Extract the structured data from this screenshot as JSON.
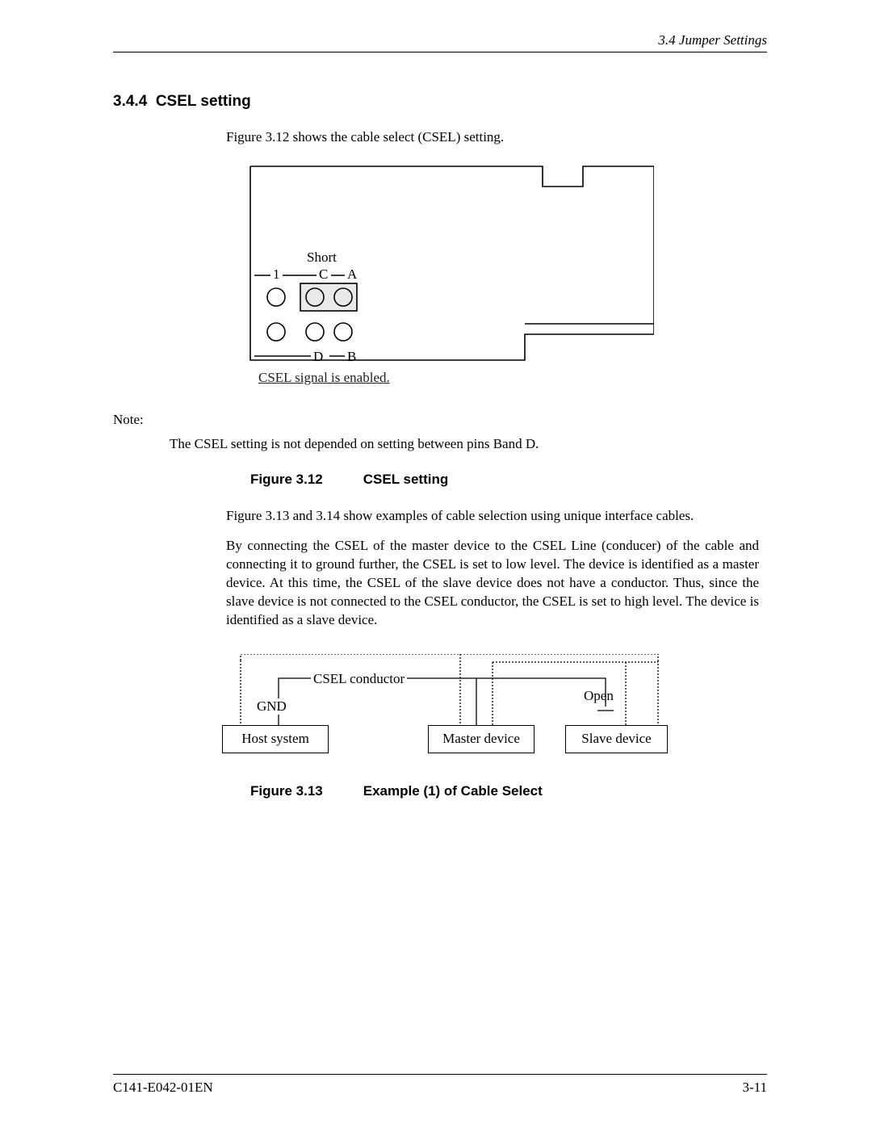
{
  "header": {
    "section_ref": "3.4  Jumper Settings"
  },
  "section": {
    "number": "3.4.4",
    "title": "CSEL setting"
  },
  "intro": "Figure 3.12 shows the cable select (CSEL) setting.",
  "fig312": {
    "short": "Short",
    "one": "1",
    "C": "C",
    "A": "A",
    "D": "D",
    "B": "B",
    "caption_note": "CSEL signal is enabled."
  },
  "note": {
    "label": "Note:",
    "text": "The CSEL setting is not depended on setting between pins Band D."
  },
  "fig312_caption": {
    "fig": "Figure 3.12",
    "title": "CSEL setting"
  },
  "para2": "Figure 3.13 and 3.14 show examples of cable selection using unique interface cables.",
  "para3": "By connecting the CSEL of the master device to the CSEL Line (conducer) of the cable and connecting it to ground further, the CSEL is set to low level.  The device is identified as a master device.  At this time, the CSEL of the slave device does not have a conductor.  Thus, since the slave device is not connected to the CSEL conductor, the CSEL is set to high level.  The device is identified as a slave device.",
  "fig313": {
    "csel_conductor": "CSEL conductor",
    "gnd": "GND",
    "open": "Open",
    "host": "Host system",
    "master": "Master device",
    "slave": "Slave device"
  },
  "fig313_caption": {
    "fig": "Figure 3.13",
    "title": "Example (1) of Cable Select"
  },
  "footer": {
    "doc": "C141-E042-01EN",
    "page": "3-11"
  }
}
